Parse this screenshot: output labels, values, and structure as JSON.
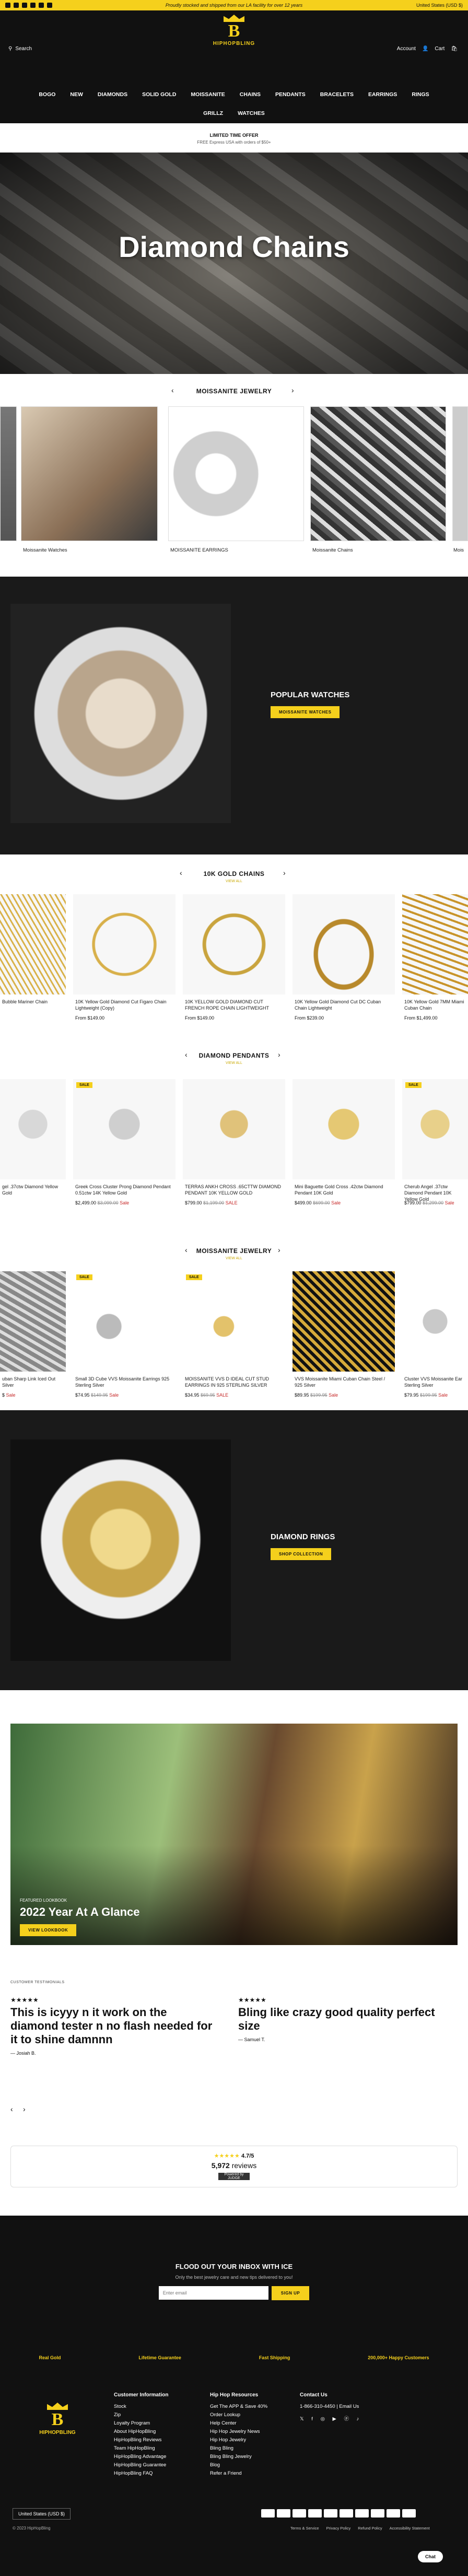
{
  "topbar": {
    "message": "Proudly stocked and shipped from our LA facility for over 12 years",
    "currency": "United States (USD $)"
  },
  "header": {
    "logo_text": "HIPHOPBLING",
    "search_label": "Search",
    "account_label": "Account",
    "cart_label": "Cart",
    "cart_count": "0"
  },
  "nav": {
    "row1": [
      "BOGO",
      "NEW",
      "DIAMONDS",
      "SOLID GOLD",
      "MOISSANITE",
      "CHAINS",
      "PENDANTS",
      "BRACELETS",
      "EARRINGS",
      "RINGS"
    ],
    "row2": [
      "GRILLZ",
      "WATCHES"
    ]
  },
  "offer": {
    "title": "LIMITED TIME OFFER",
    "subtitle": "FREE Express USA with orders of $50+"
  },
  "hero": {
    "title": "Diamond Chains"
  },
  "moissanite_carousel": {
    "title": "MOISSANITE JEWELRY",
    "items": [
      "Moissanite Watches",
      "MOISSANITE EARRINGS",
      "Moissanite Chains",
      "Mois"
    ]
  },
  "popular_watches": {
    "title": "POPULAR WATCHES",
    "button": "MOISSANITE WATCHES"
  },
  "gold_chains": {
    "title": "10K GOLD CHAINS",
    "subtitle": "VIEW ALL",
    "products": [
      {
        "name": "Bubble Mariner Chain",
        "price": ""
      },
      {
        "name": "10K Yellow Gold Diamond Cut Figaro Chain Lightweight (Copy)",
        "price": "From $149.00"
      },
      {
        "name": "10K YELLOW GOLD DIAMOND CUT FRENCH ROPE CHAIN LIGHTWEIGHT",
        "price": "From $149.00"
      },
      {
        "name": "10K Yellow Gold Diamond Cut DC Cuban Chain Lightweight",
        "price": "From $239.00"
      },
      {
        "name": "10K Yellow Gold 7MM Miami Cuban Chain",
        "price": "From $1,499.00"
      }
    ]
  },
  "diamond_pendants": {
    "title": "DIAMOND PENDANTS",
    "subtitle": "VIEW ALL",
    "products": [
      {
        "name": "gel .37ctw Diamond Yellow Gold",
        "price": "",
        "sale": ""
      },
      {
        "name": "Greek Cross Cluster Prong Diamond Pendant 0.51ctw 14K Yellow Gold",
        "price": "$2,499.00",
        "old": "$3,099.00",
        "sale": "Sale"
      },
      {
        "name": "TERRAS ANKH CROSS .65CTTW DIAMOND PENDANT 10K YELLOW GOLD",
        "price": "$799.00",
        "old": "$1,199.00",
        "sale": "SALE"
      },
      {
        "name": "Mini Baguette Gold Cross .42ctw Diamond Pendant 10K Gold",
        "price": "$499.00",
        "old": "$699.00",
        "sale": "Sale"
      },
      {
        "name": "Cherub Angel .37ctw Diamond Pendant 10K Yellow Gold",
        "price": "$799.00",
        "old": "$1,299.00",
        "sale": "Sale"
      }
    ]
  },
  "moissanite_jewelry": {
    "title": "MOISSANITE JEWELRY",
    "subtitle": "VIEW ALL",
    "products": [
      {
        "name": "uban Sharp Link Iced Out Silver",
        "price": "$",
        "old": "",
        "sale": "Sale"
      },
      {
        "name": "Small 3D Cube VVS Moissanite Earrings 925 Sterling Silver",
        "price": "$74.95",
        "old": "$149.95",
        "sale": "Sale"
      },
      {
        "name": "MOISSANITE VVS D IDEAL CUT STUD EARRINGS IN 925 STERLING SILVER",
        "price": "$34.95",
        "old": "$69.95",
        "sale": "SALE"
      },
      {
        "name": "VVS Moissanite Miami Cuban Chain Steel / 925 Silver",
        "price": "$89.95",
        "old": "$199.95",
        "sale": "Sale"
      },
      {
        "name": "Cluster VVS Moissanite Ear Sterling Silver",
        "price": "$79.95",
        "old": "$199.95",
        "sale": "Sale"
      }
    ]
  },
  "diamond_rings": {
    "title": "DIAMOND RINGS",
    "button": "SHOP COLLECTION"
  },
  "lookbook": {
    "tag": "FEATURED LOOKBOOK",
    "title": "2022 Year At A Glance",
    "button": "VIEW LOOKBOOK"
  },
  "testimonials": {
    "label": "CUSTOMER TESTIMONIALS",
    "items": [
      {
        "stars": "★★★★★",
        "quote": "This is icyyy n it work on the diamond tester n no flash needed for it to shine damnnn",
        "author": "— Josiah B."
      },
      {
        "stars": "★★★★★",
        "quote": "Bling like crazy good quality perfect size",
        "author": "— Samuel T."
      }
    ]
  },
  "reviews": {
    "stars": "★★★★★",
    "rating": "4.7/5",
    "count": "5,972",
    "count_label": "reviews",
    "powered": "Powered by JUDGE"
  },
  "newsletter": {
    "title": "FLOOD OUT YOUR INBOX WITH ICE",
    "subtitle": "Only the best jewelry care and new tips delivered to you!",
    "placeholder": "Enter email",
    "button": "SIGN UP"
  },
  "features": [
    "Real Gold",
    "Lifetime Guarantee",
    "Fast Shipping",
    "200,000+ Happy Customers"
  ],
  "footer": {
    "info_title": "Customer Information",
    "info": [
      "Stock",
      "Zip",
      "Loyalty Program",
      "About HipHopBling",
      "HipHopBling Reviews",
      "Team HipHopBling",
      "HipHopBling Advantage",
      "HipHopBling Guarantee",
      "HipHopBling FAQ"
    ],
    "res_title": "Hip Hop Resources",
    "res": [
      "Get The APP & Save 40%",
      "Order Lookup",
      "Help Center",
      "Hip Hop Jewelry News",
      "Hip Hop Jewelry",
      "Bling Bling",
      "Bling Bling Jewelry",
      "Blog",
      "Refer a Friend"
    ],
    "contact_title": "Contact Us",
    "phone": "1-866-310-4450 | Email Us",
    "currency": "United States (USD $)",
    "copyright": "© 2023 HipHopBling",
    "legal": [
      "Terms & Service",
      "Privacy Policy",
      "Refund Policy",
      "Accessibility Statement"
    ],
    "chat": "Chat"
  },
  "colors": {
    "accent": "#f5d01c",
    "dark": "#1a1a1a"
  }
}
